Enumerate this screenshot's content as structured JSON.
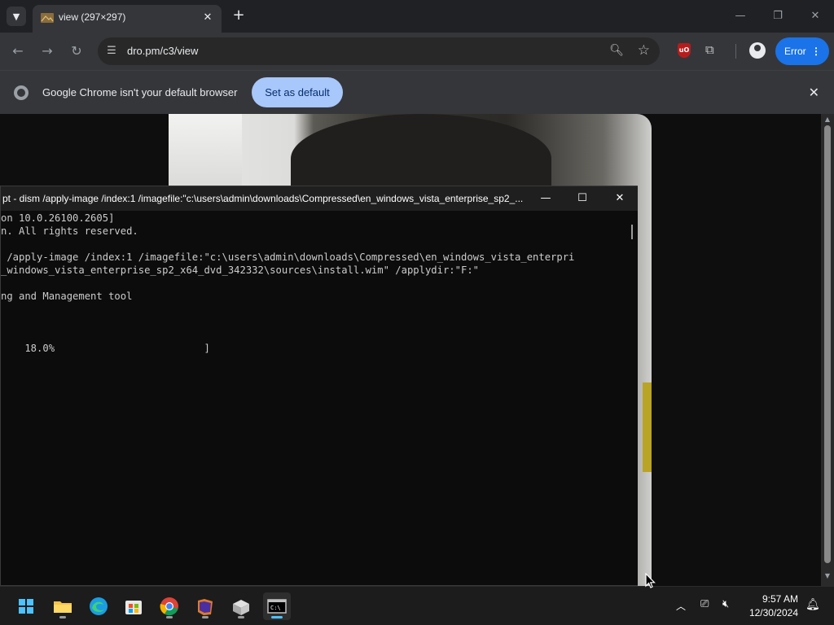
{
  "browser": {
    "tab": {
      "title": "view (297×297)",
      "close_glyph": "✕"
    },
    "new_tab_glyph": "+",
    "window_controls": {
      "minimize": "—",
      "restore": "❐",
      "close": "✕"
    },
    "nav": {
      "back": "←",
      "forward": "→",
      "reload": "↻"
    },
    "url": "dro.pm/c3/view",
    "error_button": "Error",
    "infobar": {
      "message": "Google Chrome isn't your default browser",
      "button": "Set as default"
    }
  },
  "cmd": {
    "title": "pt - dism  /apply-image /index:1 /imagefile:\"c:\\users\\admin\\downloads\\Compressed\\en_windows_vista_enterprise_sp2_...",
    "lines": [
      "on 10.0.26100.2605]",
      "n. All rights reserved.",
      "",
      " /apply-image /index:1 /imagefile:\"c:\\users\\admin\\downloads\\Compressed\\en_windows_vista_enterpri",
      "_windows_vista_enterprise_sp2_x64_dvd_342332\\sources\\install.wim\" /applydir:\"F:\"",
      "",
      "ng and Management tool",
      "",
      "",
      "",
      "    18.0%                         ]"
    ]
  },
  "taskbar": {
    "apps": [
      "start-icon",
      "file-explorer-icon",
      "edge-icon",
      "store-icon",
      "chrome-icon",
      "winrar-icon",
      "package-icon",
      "terminal-icon"
    ],
    "time": "9:57 AM",
    "date": "12/30/2024"
  },
  "colors": {
    "accent": "#1a73e8",
    "infobar_button": "#a8c7fa",
    "terminal_bg": "#0c0c0c",
    "taskbar_active": "#4cc2ff"
  }
}
